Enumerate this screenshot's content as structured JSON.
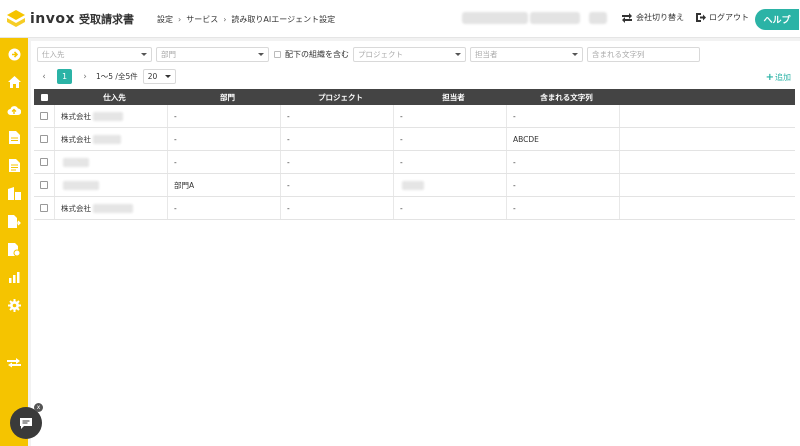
{
  "header": {
    "brand": "invox",
    "product": "受取請求書",
    "breadcrumb": [
      "設定",
      "サービス",
      "読み取りAIエージェント設定"
    ],
    "company_switch_label": "会社切り替え",
    "logout_label": "ログアウト",
    "help_label": "ヘルプ"
  },
  "sidebar": {
    "icons": [
      "arrow-right-circle-icon",
      "home-icon",
      "cloud-upload-icon",
      "document-icon",
      "document-list-icon",
      "building-icon",
      "document-export-icon",
      "document-check-icon",
      "chart-icon",
      "gear-icon",
      "transfer-icon"
    ]
  },
  "filters": {
    "supplier_placeholder": "仕入先",
    "department_placeholder": "部門",
    "include_sub_label": "配下の組織を含む",
    "project_placeholder": "プロジェクト",
    "assignee_placeholder": "担当者",
    "contains_text_placeholder": "含まれる文字列"
  },
  "pagination": {
    "current_page": "1",
    "range_text": "1〜5 /全5件",
    "page_size": "20"
  },
  "actions": {
    "add_label": "追加"
  },
  "table": {
    "headers": [
      "仕入先",
      "部門",
      "プロジェクト",
      "担当者",
      "含まれる文字列"
    ],
    "rows": [
      {
        "supplier": "株式会社",
        "department": "-",
        "project": "-",
        "assignee": "-",
        "text": "-"
      },
      {
        "supplier": "株式会社",
        "department": "-",
        "project": "-",
        "assignee": "-",
        "text": "ABCDE"
      },
      {
        "supplier": "",
        "department": "-",
        "project": "-",
        "assignee": "-",
        "text": "-"
      },
      {
        "supplier": "",
        "department": "部門A",
        "project": "-",
        "assignee": "",
        "text": "-"
      },
      {
        "supplier": "株式会社",
        "department": "-",
        "project": "-",
        "assignee": "-",
        "text": "-"
      }
    ]
  },
  "colors": {
    "accent": "#2bb3a6",
    "sidebar": "#f5c400",
    "table_header": "#444444"
  }
}
